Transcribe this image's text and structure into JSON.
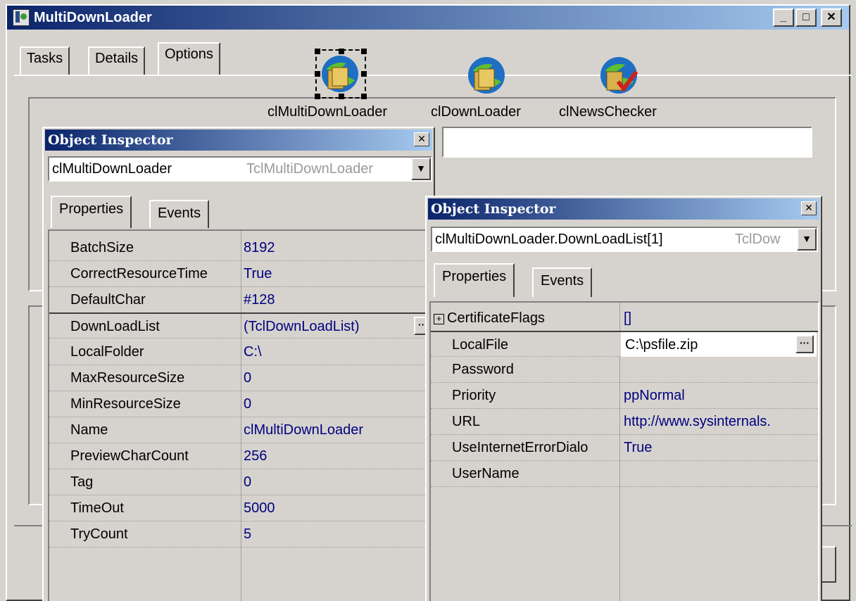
{
  "window": {
    "title": "MultiDownLoader",
    "controls": [
      "_",
      "□",
      "✕"
    ]
  },
  "tabs": [
    "Tasks",
    "Details",
    "Options"
  ],
  "components": [
    {
      "label": "clMultiDownLoader",
      "icon": "download-component-icon"
    },
    {
      "label": "clDownLoader",
      "icon": "download-component-icon"
    },
    {
      "label": "clNewsChecker",
      "icon": "news-checker-icon"
    }
  ],
  "inspector1": {
    "title": "Object Inspector",
    "object_name": "clMultiDownLoader",
    "object_class": "TclMultiDownLoader",
    "tabs": [
      "Properties",
      "Events"
    ],
    "properties": [
      {
        "name": "BatchSize",
        "value": "8192"
      },
      {
        "name": "CorrectResourceTime",
        "value": "True"
      },
      {
        "name": "DefaultChar",
        "value": "#128"
      },
      {
        "name": "DownLoadList",
        "value": "(TclDownLoadList)"
      },
      {
        "name": "LocalFolder",
        "value": "C:\\"
      },
      {
        "name": "MaxResourceSize",
        "value": "0"
      },
      {
        "name": "MinResourceSize",
        "value": "0"
      },
      {
        "name": "Name",
        "value": "clMultiDownLoader"
      },
      {
        "name": "PreviewCharCount",
        "value": "256"
      },
      {
        "name": "Tag",
        "value": "0"
      },
      {
        "name": "TimeOut",
        "value": "5000"
      },
      {
        "name": "TryCount",
        "value": "5"
      }
    ]
  },
  "inspector2": {
    "title": "Object Inspector",
    "object_name": "clMultiDownLoader.DownLoadList[1]",
    "object_class": "TclDow",
    "tabs": [
      "Properties",
      "Events"
    ],
    "properties": [
      {
        "name": "CertificateFlags",
        "value": "[]"
      },
      {
        "name": "LocalFile",
        "value": "C:\\psfile.zip"
      },
      {
        "name": "Password",
        "value": ""
      },
      {
        "name": "Priority",
        "value": "ppNormal"
      },
      {
        "name": "URL",
        "value": "http://www.sysinternals."
      },
      {
        "name": "UseInternetErrorDialo",
        "value": "True"
      },
      {
        "name": "UserName",
        "value": ""
      }
    ]
  },
  "colors": {
    "titlebar_start": "#0a246a",
    "titlebar_end": "#a6caf0",
    "value_text": "#000080",
    "face": "#d6d3ce"
  }
}
